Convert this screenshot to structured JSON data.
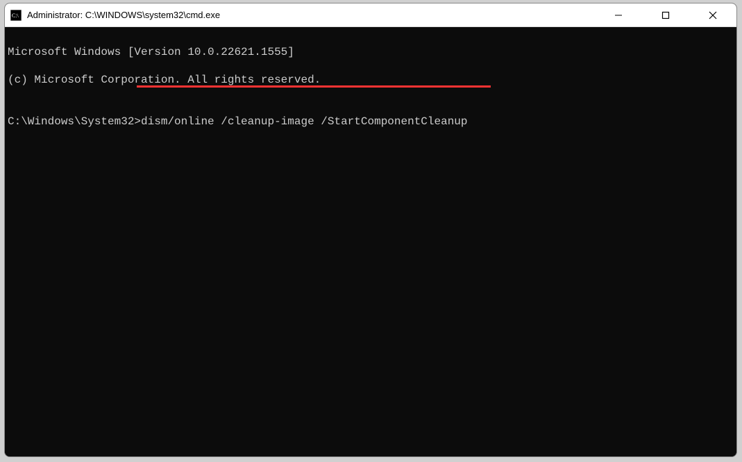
{
  "window": {
    "title": "Administrator: C:\\WINDOWS\\system32\\cmd.exe"
  },
  "terminal": {
    "line1": "Microsoft Windows [Version 10.0.22621.1555]",
    "line2": "(c) Microsoft Corporation. All rights reserved.",
    "blank": "",
    "prompt": "C:\\Windows\\System32>",
    "command": "dism/online /cleanup-image /StartComponentCleanup"
  },
  "annotation": {
    "underline_color": "#ff3333"
  }
}
